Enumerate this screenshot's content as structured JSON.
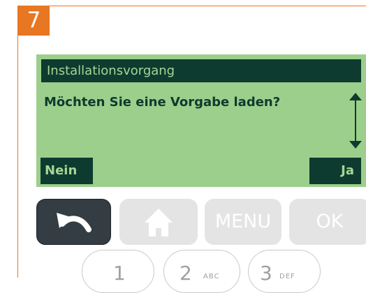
{
  "step": {
    "number": "7"
  },
  "display": {
    "header": "Installationsvorgang",
    "question": "Möchten Sie eine Vorgabe laden?",
    "softkey_left": "Nein",
    "softkey_right": "Ja"
  },
  "keys": {
    "back_icon": "back-arrow-icon",
    "home_icon": "home-icon",
    "menu_label": "MENU",
    "ok_label": "OK"
  },
  "numpad": [
    {
      "number": "1",
      "letters": ""
    },
    {
      "number": "2",
      "letters": "ABC"
    },
    {
      "number": "3",
      "letters": "DEF"
    }
  ],
  "colors": {
    "accent": "#e87722",
    "screen_bg": "#9ccf8b",
    "screen_dark": "#0d3b2f",
    "key_gray": "#e4e4e4",
    "back_key": "#333d43"
  }
}
